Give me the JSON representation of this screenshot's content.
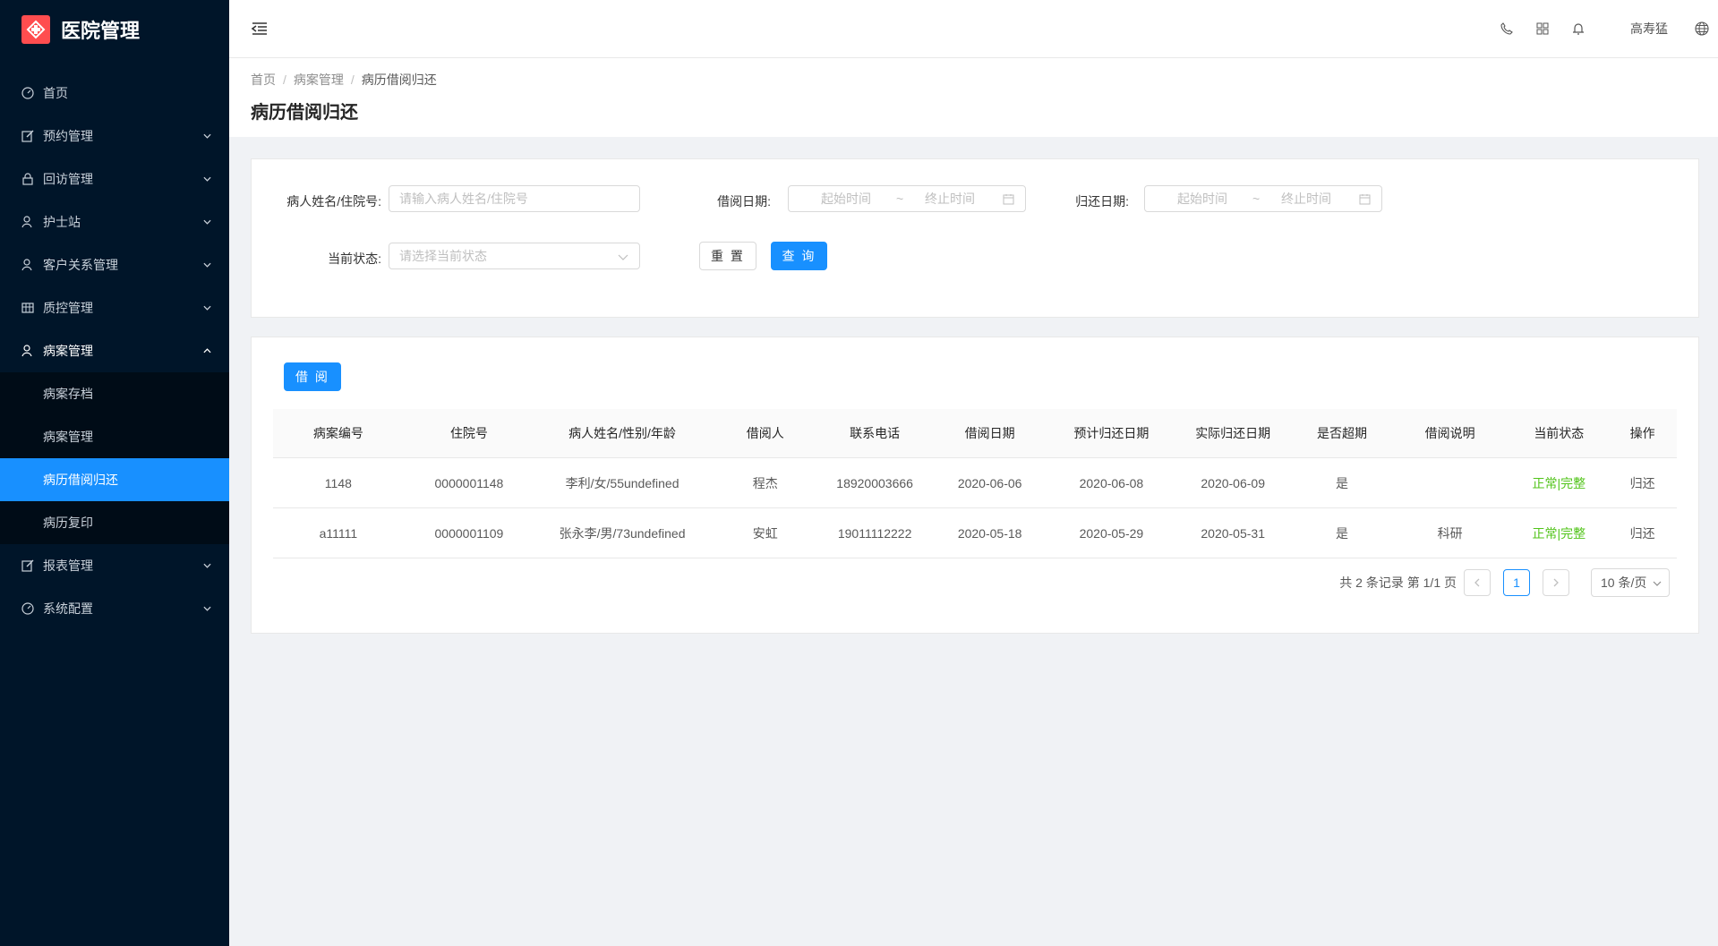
{
  "app": {
    "title": "医院管理"
  },
  "sidebar": {
    "items": [
      {
        "label": "首页",
        "icon": "dashboard-icon"
      },
      {
        "label": "预约管理",
        "icon": "edit-icon"
      },
      {
        "label": "回访管理",
        "icon": "lock-icon"
      },
      {
        "label": "护士站",
        "icon": "user-icon"
      },
      {
        "label": "客户关系管理",
        "icon": "user-icon"
      },
      {
        "label": "质控管理",
        "icon": "table-icon"
      },
      {
        "label": "病案管理",
        "icon": "user-icon"
      },
      {
        "label": "报表管理",
        "icon": "edit-icon"
      },
      {
        "label": "系统配置",
        "icon": "dashboard-icon"
      }
    ],
    "submenu": [
      {
        "label": "病案存档"
      },
      {
        "label": "病案管理"
      },
      {
        "label": "病历借阅归还"
      },
      {
        "label": "病历复印"
      }
    ]
  },
  "header": {
    "user": "高寿猛"
  },
  "breadcrumb": {
    "home": "首页",
    "parent": "病案管理",
    "current": "病历借阅归还"
  },
  "page": {
    "title": "病历借阅归还"
  },
  "search": {
    "name_label": "病人姓名/住院号:",
    "name_placeholder": "请输入病人姓名/住院号",
    "borrow_label": "借阅日期:",
    "return_label": "归还日期:",
    "start_placeholder": "起始时间",
    "end_placeholder": "终止时间",
    "range_sep": "~",
    "status_label": "当前状态:",
    "status_placeholder": "请选择当前状态",
    "reset": "重 置",
    "query": "查 询"
  },
  "toolbar": {
    "borrow": "借 阅"
  },
  "table": {
    "columns": [
      "病案编号",
      "住院号",
      "病人姓名/性别/年龄",
      "借阅人",
      "联系电话",
      "借阅日期",
      "预计归还日期",
      "实际归还日期",
      "是否超期",
      "借阅说明",
      "当前状态",
      "操作"
    ],
    "rows": [
      {
        "case_no": "1148",
        "inpatient_no": "0000001148",
        "patient": "李利/女/55undefined",
        "borrower": "程杰",
        "phone": "18920003666",
        "borrow_date": "2020-06-06",
        "expected_return": "2020-06-08",
        "actual_return": "2020-06-09",
        "overdue": "是",
        "note": "",
        "status": "正常|完整",
        "action": "归还"
      },
      {
        "case_no": "a11111",
        "inpatient_no": "0000001109",
        "patient": "张永李/男/73undefined",
        "borrower": "安虹",
        "phone": "19011112222",
        "borrow_date": "2020-05-18",
        "expected_return": "2020-05-29",
        "actual_return": "2020-05-31",
        "overdue": "是",
        "note": "科研",
        "status": "正常|完整",
        "action": "归还"
      }
    ]
  },
  "pagination": {
    "summary": "共 2 条记录 第 1/1 页",
    "current": "1",
    "page_size": "10 条/页"
  },
  "colors": {
    "primary": "#1890ff",
    "sider": "#001529",
    "status_ok": "#52c41a",
    "logo": "#ff4d4f"
  }
}
